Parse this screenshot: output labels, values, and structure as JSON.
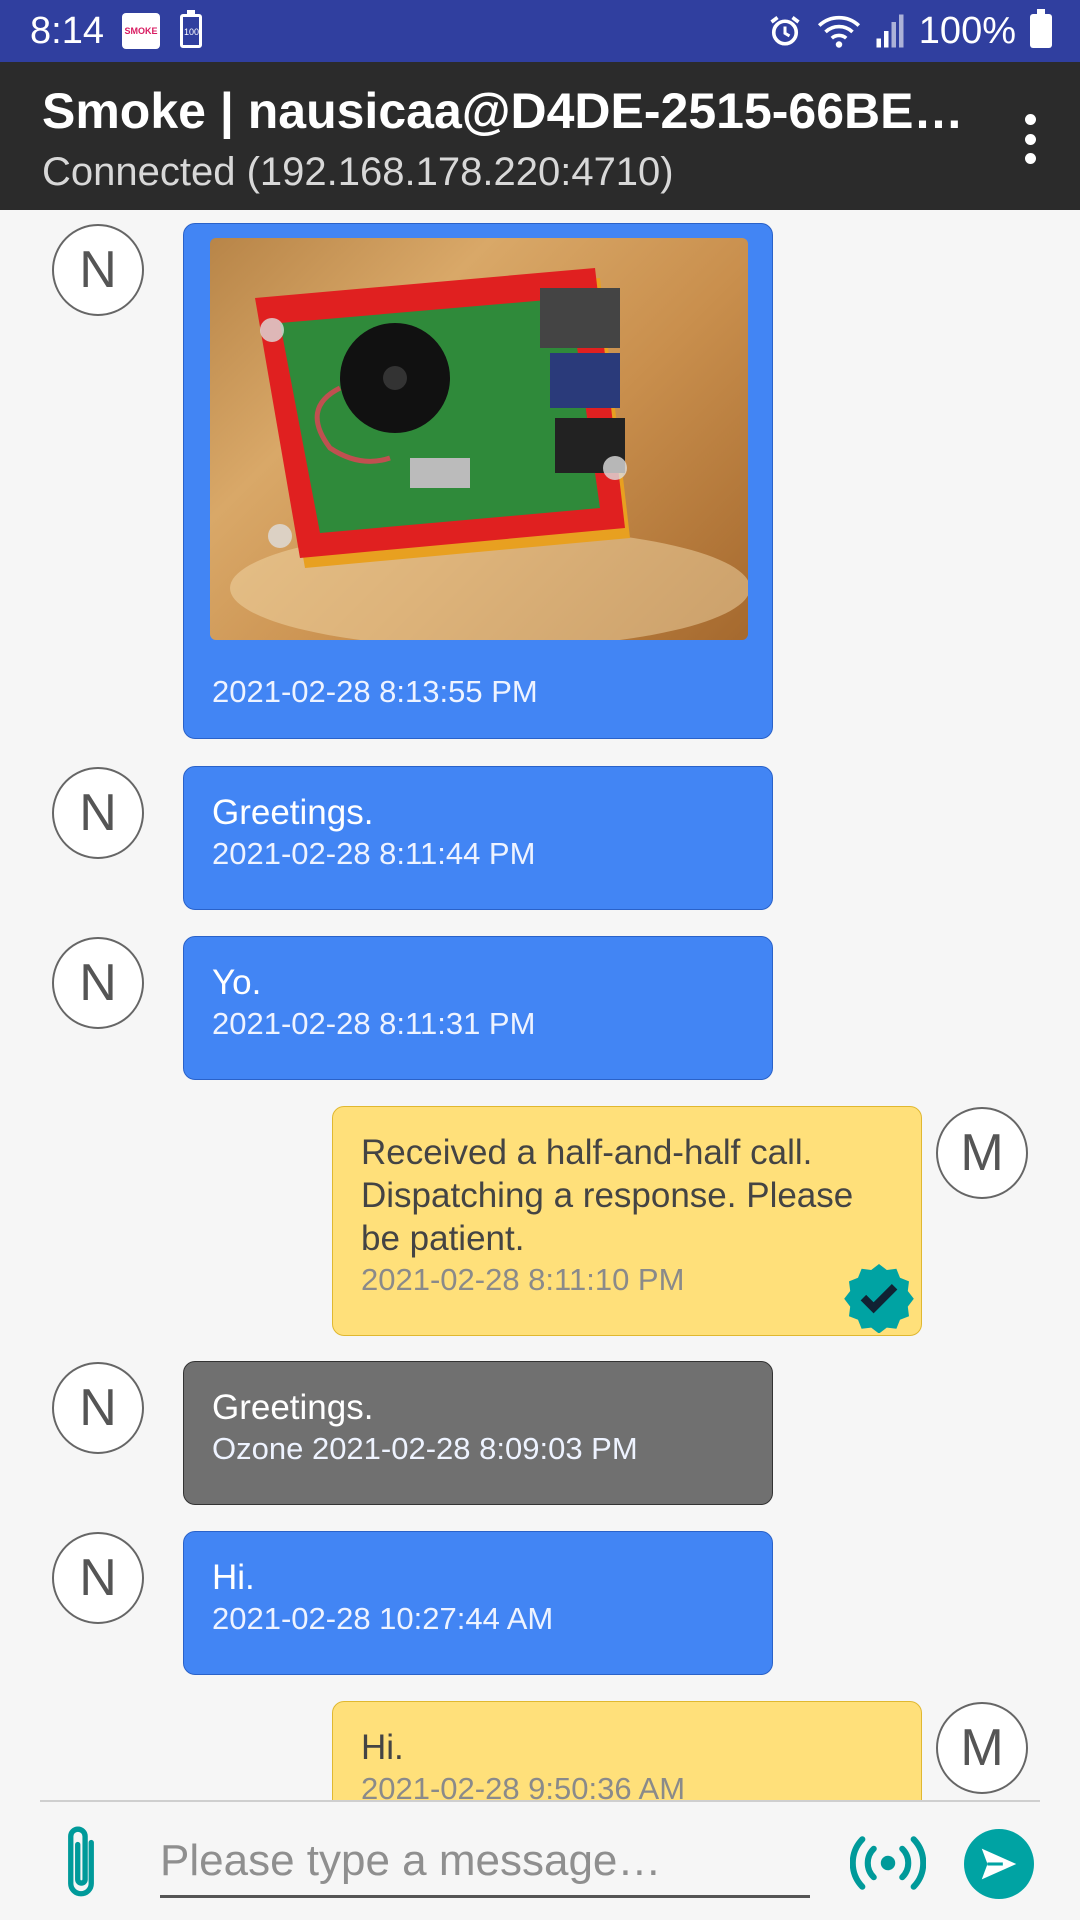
{
  "status_bar": {
    "time": "8:14",
    "battery_small_label": "100",
    "app_icon_label": "SMOKE",
    "battery_percent": "100%",
    "icons": [
      "smoke-app-icon",
      "battery-saver-icon",
      "alarm-icon",
      "wifi-icon",
      "signal-icon",
      "battery-icon"
    ]
  },
  "toolbar": {
    "title": "Smoke | nausicaa@D4DE-2515-66BE…",
    "subtitle": "Connected (192.168.178.220:4710)",
    "menu_icon": "more-vert-icon"
  },
  "messages": [
    {
      "side": "left",
      "avatar": "N",
      "color": "blue",
      "has_image": true,
      "text": "",
      "timestamp": "2021-02-28 8:13:55 PM"
    },
    {
      "side": "left",
      "avatar": "N",
      "color": "blue",
      "text": "Greetings.",
      "timestamp": "2021-02-28 8:11:44 PM"
    },
    {
      "side": "left",
      "avatar": "N",
      "color": "blue",
      "text": "Yo.",
      "timestamp": "2021-02-28 8:11:31 PM"
    },
    {
      "side": "right",
      "avatar": "M",
      "color": "yellow",
      "text": "Received a half-and-half call. Dispatching a response. Please be patient.",
      "timestamp": "2021-02-28 8:11:10 PM",
      "verified": true
    },
    {
      "side": "left",
      "avatar": "N",
      "color": "gray",
      "text": "Greetings.",
      "timestamp": "Ozone 2021-02-28 8:09:03 PM"
    },
    {
      "side": "left",
      "avatar": "N",
      "color": "blue",
      "text": "Hi.",
      "timestamp": "2021-02-28 10:27:44 AM"
    },
    {
      "side": "right",
      "avatar": "M",
      "color": "yellow",
      "text": "Hi.",
      "timestamp": "2021-02-28 9:50:36 AM"
    }
  ],
  "input": {
    "placeholder": "Please type a message…",
    "value": ""
  },
  "colors": {
    "status_bar": "#303f9f",
    "toolbar": "#2b2b2b",
    "bubble_blue": "#4285f4",
    "bubble_gray": "#707070",
    "bubble_yellow": "#ffe07a",
    "accent_teal": "#00a3a3"
  }
}
